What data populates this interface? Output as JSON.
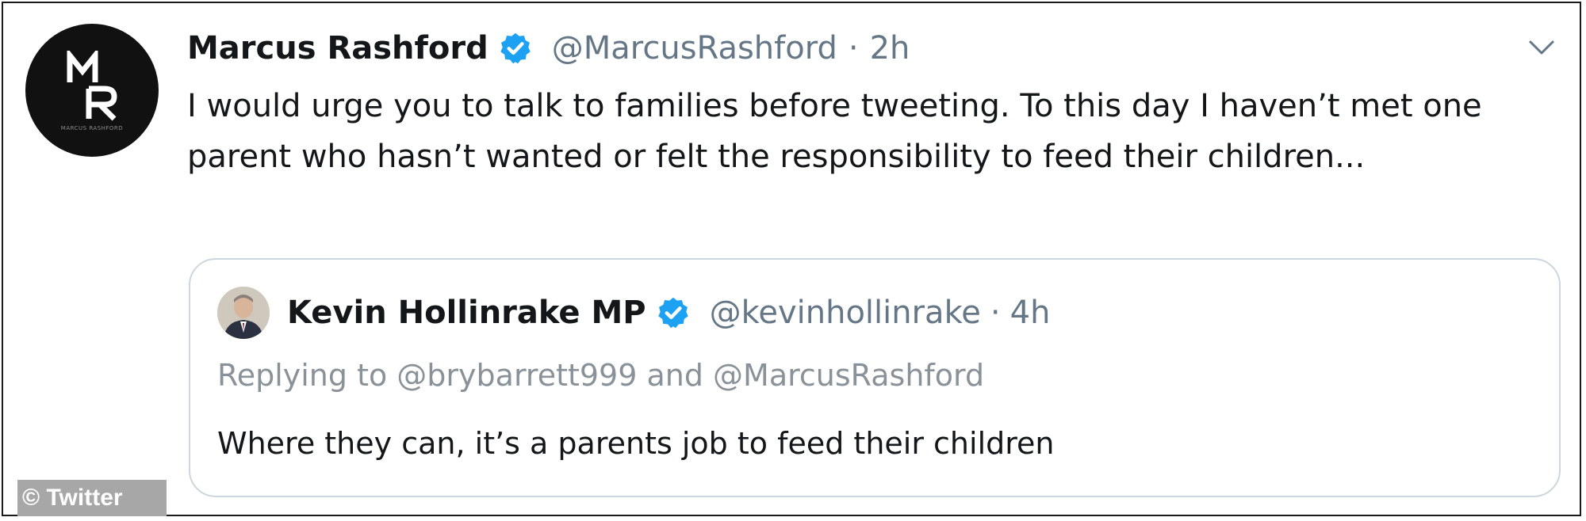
{
  "tweet": {
    "author": {
      "name": "Marcus Rashford",
      "handle": "@MarcusRashford",
      "time": "2h",
      "separator": "·",
      "avatar_text": "MARCUS RASHFORD"
    },
    "text": "I would urge you to talk to families before tweeting. To this day I haven’t met one parent who hasn’t wanted or felt the responsibility to feed their children..."
  },
  "quoted_tweet": {
    "author": {
      "name": "Kevin Hollinrake MP",
      "handle": "@kevinhollinrake",
      "time": "4h",
      "separator": "·"
    },
    "replying_to": "Replying to @brybarrett999 and @MarcusRashford",
    "text": "Where they can, it’s a parents job to feed their children"
  },
  "watermark": "© Twitter",
  "icons": {
    "verified": "verified-badge-icon",
    "more": "chevron-down-icon"
  },
  "colors": {
    "verified_blue": "#1da1f2",
    "secondary_text": "#657786",
    "border": "#ccd6dd"
  }
}
